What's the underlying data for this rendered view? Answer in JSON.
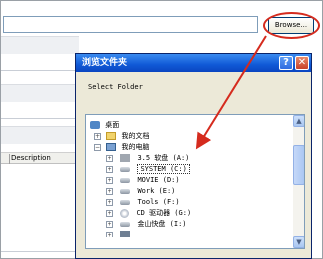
{
  "parent": {
    "browse_label": "Browse...",
    "description_header": "Description"
  },
  "dialog": {
    "title": "浏览文件夹",
    "help_glyph": "?",
    "close_glyph": "✕",
    "prompt": "Select Folder",
    "tree": {
      "desktop": "桌面",
      "my_documents": "我的文档",
      "my_computer": "我的电脑",
      "drives": [
        {
          "label": "3.5 软盘 (A:)"
        },
        {
          "label": "SYSTEM (C:)"
        },
        {
          "label": "MOVIE (D:)"
        },
        {
          "label": "Work (E:)"
        },
        {
          "label": "Tools (F:)"
        },
        {
          "label": "CD 驱动器 (G:)"
        },
        {
          "label": "金山快盘 (I:)"
        }
      ]
    },
    "scroll_up": "▲",
    "scroll_down": "▼"
  },
  "annotation": {
    "color": "#d52b1e"
  }
}
